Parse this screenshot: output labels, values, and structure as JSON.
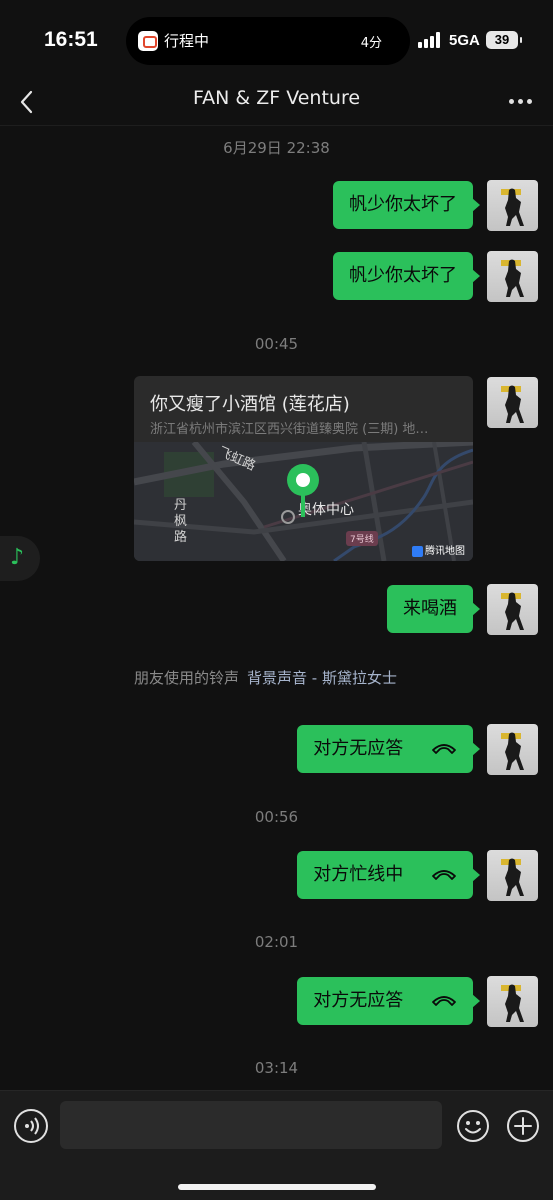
{
  "status_bar": {
    "time": "16:51",
    "activity_label": "行程中",
    "activity_time": "4分",
    "network": "5GA",
    "battery": "39"
  },
  "header": {
    "title": "FAN & ZF Venture"
  },
  "messages": {
    "timestamp_1": "6月29日 22:38",
    "msg_1": "帆少你太坏了",
    "msg_2": "帆少你太坏了",
    "timestamp_2": "00:45",
    "location": {
      "title": "你又瘦了小酒馆 (莲花店)",
      "address": "浙江省杭州市滨江区西兴街道臻奥院 (三期) 地…",
      "road_1": "飞虹路",
      "road_2": "丹枫路",
      "poi": "奥体中心",
      "metro_line": "7号线",
      "map_brand": "腾讯地图"
    },
    "msg_3": "来喝酒",
    "ringtone_prefix": "朋友使用的铃声",
    "ringtone_link": "背景声音 - 斯黛拉女士",
    "call_1": "对方无应答",
    "timestamp_3": "00:56",
    "call_2": "对方忙线中",
    "timestamp_4": "02:01",
    "call_3": "对方无应答",
    "timestamp_5": "03:14"
  },
  "input": {
    "placeholder": ""
  },
  "colors": {
    "bubble_green": "#2bc05b",
    "background": "#111111"
  },
  "icons": [
    "back-chevron-icon",
    "more-dots-icon",
    "music-note-icon",
    "voice-icon",
    "emoji-icon",
    "plus-icon",
    "hangup-phone-icon",
    "map-pin-icon"
  ]
}
